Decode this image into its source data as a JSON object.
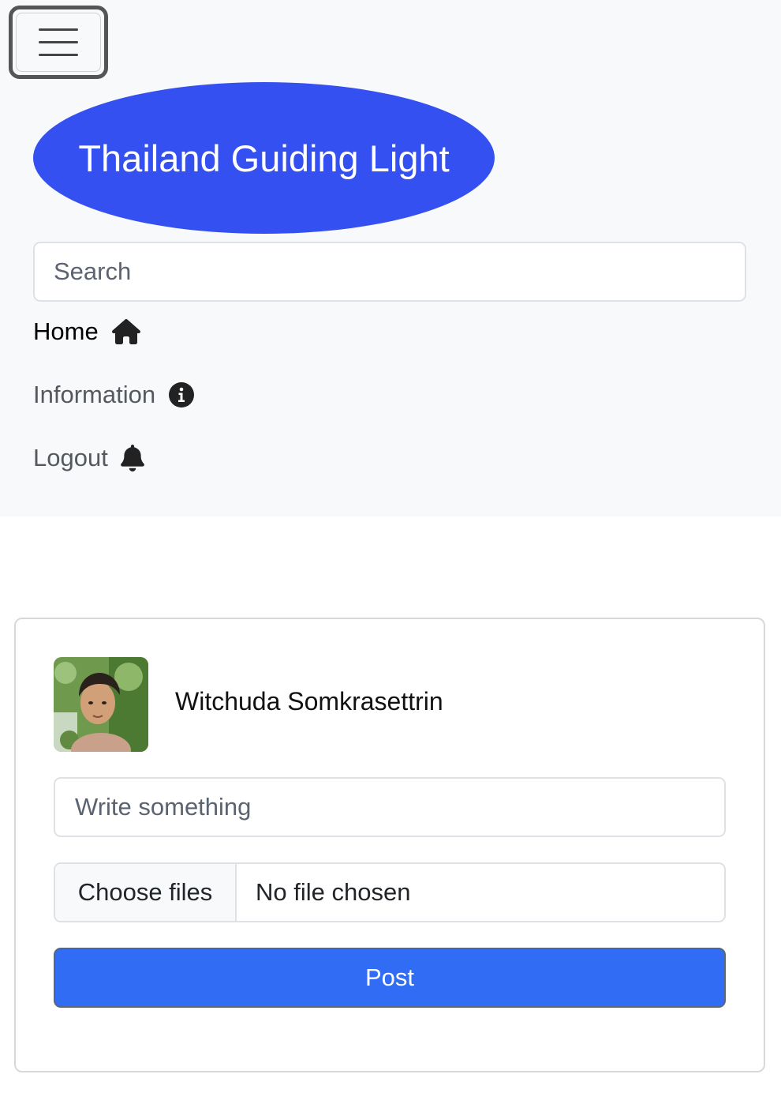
{
  "header": {
    "brand_title": "Thailand Guiding Light",
    "search_placeholder": "Search",
    "menu_icon": "hamburger-menu-icon"
  },
  "nav": {
    "items": [
      {
        "label": "Home",
        "icon": "home-icon",
        "active": true
      },
      {
        "label": "Information",
        "icon": "info-circle-icon",
        "active": false
      },
      {
        "label": "Logout",
        "icon": "bell-icon",
        "active": false
      }
    ]
  },
  "composer": {
    "user_name": "Witchuda Somkrasettrin",
    "post_placeholder": "Write something",
    "choose_files_label": "Choose files",
    "file_status": "No file chosen",
    "post_button_label": "Post"
  },
  "colors": {
    "brand_bg": "#3550f0",
    "navbar_bg": "#f8f9fa",
    "primary_button": "#316cf4"
  }
}
